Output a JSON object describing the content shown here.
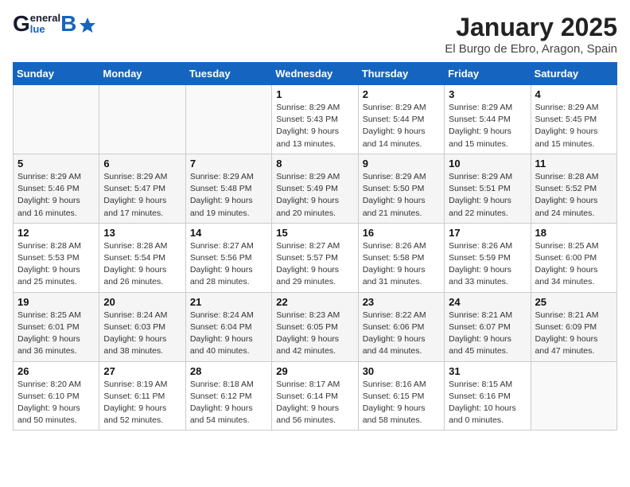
{
  "header": {
    "logo_general": "General",
    "logo_blue": "Blue",
    "month_title": "January 2025",
    "location": "El Burgo de Ebro, Aragon, Spain"
  },
  "weekdays": [
    "Sunday",
    "Monday",
    "Tuesday",
    "Wednesday",
    "Thursday",
    "Friday",
    "Saturday"
  ],
  "weeks": [
    [
      {
        "day": "",
        "info": ""
      },
      {
        "day": "",
        "info": ""
      },
      {
        "day": "",
        "info": ""
      },
      {
        "day": "1",
        "info": "Sunrise: 8:29 AM\nSunset: 5:43 PM\nDaylight: 9 hours\nand 13 minutes."
      },
      {
        "day": "2",
        "info": "Sunrise: 8:29 AM\nSunset: 5:44 PM\nDaylight: 9 hours\nand 14 minutes."
      },
      {
        "day": "3",
        "info": "Sunrise: 8:29 AM\nSunset: 5:44 PM\nDaylight: 9 hours\nand 15 minutes."
      },
      {
        "day": "4",
        "info": "Sunrise: 8:29 AM\nSunset: 5:45 PM\nDaylight: 9 hours\nand 15 minutes."
      }
    ],
    [
      {
        "day": "5",
        "info": "Sunrise: 8:29 AM\nSunset: 5:46 PM\nDaylight: 9 hours\nand 16 minutes."
      },
      {
        "day": "6",
        "info": "Sunrise: 8:29 AM\nSunset: 5:47 PM\nDaylight: 9 hours\nand 17 minutes."
      },
      {
        "day": "7",
        "info": "Sunrise: 8:29 AM\nSunset: 5:48 PM\nDaylight: 9 hours\nand 19 minutes."
      },
      {
        "day": "8",
        "info": "Sunrise: 8:29 AM\nSunset: 5:49 PM\nDaylight: 9 hours\nand 20 minutes."
      },
      {
        "day": "9",
        "info": "Sunrise: 8:29 AM\nSunset: 5:50 PM\nDaylight: 9 hours\nand 21 minutes."
      },
      {
        "day": "10",
        "info": "Sunrise: 8:29 AM\nSunset: 5:51 PM\nDaylight: 9 hours\nand 22 minutes."
      },
      {
        "day": "11",
        "info": "Sunrise: 8:28 AM\nSunset: 5:52 PM\nDaylight: 9 hours\nand 24 minutes."
      }
    ],
    [
      {
        "day": "12",
        "info": "Sunrise: 8:28 AM\nSunset: 5:53 PM\nDaylight: 9 hours\nand 25 minutes."
      },
      {
        "day": "13",
        "info": "Sunrise: 8:28 AM\nSunset: 5:54 PM\nDaylight: 9 hours\nand 26 minutes."
      },
      {
        "day": "14",
        "info": "Sunrise: 8:27 AM\nSunset: 5:56 PM\nDaylight: 9 hours\nand 28 minutes."
      },
      {
        "day": "15",
        "info": "Sunrise: 8:27 AM\nSunset: 5:57 PM\nDaylight: 9 hours\nand 29 minutes."
      },
      {
        "day": "16",
        "info": "Sunrise: 8:26 AM\nSunset: 5:58 PM\nDaylight: 9 hours\nand 31 minutes."
      },
      {
        "day": "17",
        "info": "Sunrise: 8:26 AM\nSunset: 5:59 PM\nDaylight: 9 hours\nand 33 minutes."
      },
      {
        "day": "18",
        "info": "Sunrise: 8:25 AM\nSunset: 6:00 PM\nDaylight: 9 hours\nand 34 minutes."
      }
    ],
    [
      {
        "day": "19",
        "info": "Sunrise: 8:25 AM\nSunset: 6:01 PM\nDaylight: 9 hours\nand 36 minutes."
      },
      {
        "day": "20",
        "info": "Sunrise: 8:24 AM\nSunset: 6:03 PM\nDaylight: 9 hours\nand 38 minutes."
      },
      {
        "day": "21",
        "info": "Sunrise: 8:24 AM\nSunset: 6:04 PM\nDaylight: 9 hours\nand 40 minutes."
      },
      {
        "day": "22",
        "info": "Sunrise: 8:23 AM\nSunset: 6:05 PM\nDaylight: 9 hours\nand 42 minutes."
      },
      {
        "day": "23",
        "info": "Sunrise: 8:22 AM\nSunset: 6:06 PM\nDaylight: 9 hours\nand 44 minutes."
      },
      {
        "day": "24",
        "info": "Sunrise: 8:21 AM\nSunset: 6:07 PM\nDaylight: 9 hours\nand 45 minutes."
      },
      {
        "day": "25",
        "info": "Sunrise: 8:21 AM\nSunset: 6:09 PM\nDaylight: 9 hours\nand 47 minutes."
      }
    ],
    [
      {
        "day": "26",
        "info": "Sunrise: 8:20 AM\nSunset: 6:10 PM\nDaylight: 9 hours\nand 50 minutes."
      },
      {
        "day": "27",
        "info": "Sunrise: 8:19 AM\nSunset: 6:11 PM\nDaylight: 9 hours\nand 52 minutes."
      },
      {
        "day": "28",
        "info": "Sunrise: 8:18 AM\nSunset: 6:12 PM\nDaylight: 9 hours\nand 54 minutes."
      },
      {
        "day": "29",
        "info": "Sunrise: 8:17 AM\nSunset: 6:14 PM\nDaylight: 9 hours\nand 56 minutes."
      },
      {
        "day": "30",
        "info": "Sunrise: 8:16 AM\nSunset: 6:15 PM\nDaylight: 9 hours\nand 58 minutes."
      },
      {
        "day": "31",
        "info": "Sunrise: 8:15 AM\nSunset: 6:16 PM\nDaylight: 10 hours\nand 0 minutes."
      },
      {
        "day": "",
        "info": ""
      }
    ]
  ]
}
